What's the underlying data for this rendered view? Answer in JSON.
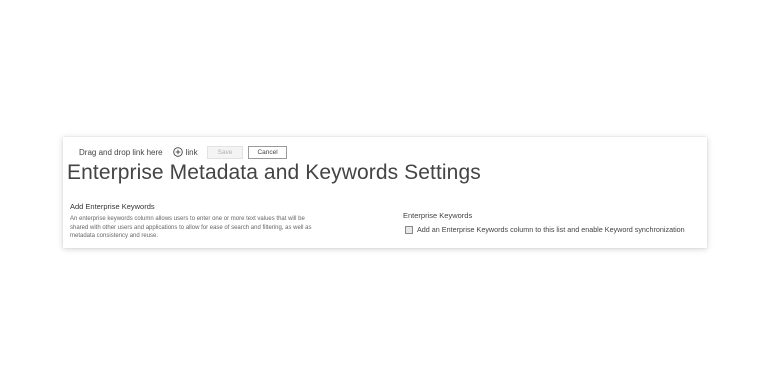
{
  "toolbar": {
    "drag_text": "Drag and drop link here",
    "link_label": "link",
    "save_label": "Save",
    "cancel_label": "Cancel",
    "icon": "plus-circle-icon"
  },
  "page": {
    "title": "Enterprise Metadata and Keywords Settings"
  },
  "add_keywords_section": {
    "heading": "Add Enterprise Keywords",
    "description_lines": [
      "An enterprise keywords column allows users to enter one or more text values that will be",
      "shared with other users and applications to allow for ease of search and filtering, as well as",
      "metadata consistency and reuse."
    ]
  },
  "keywords_field": {
    "label": "Enterprise Keywords",
    "checkbox_label": "Add an Enterprise Keywords column to this list and enable Keyword synchronization",
    "checked": false
  },
  "colors": {
    "text": "#444444",
    "muted_text": "#666666",
    "disabled_button_text": "#b0b0b0"
  }
}
